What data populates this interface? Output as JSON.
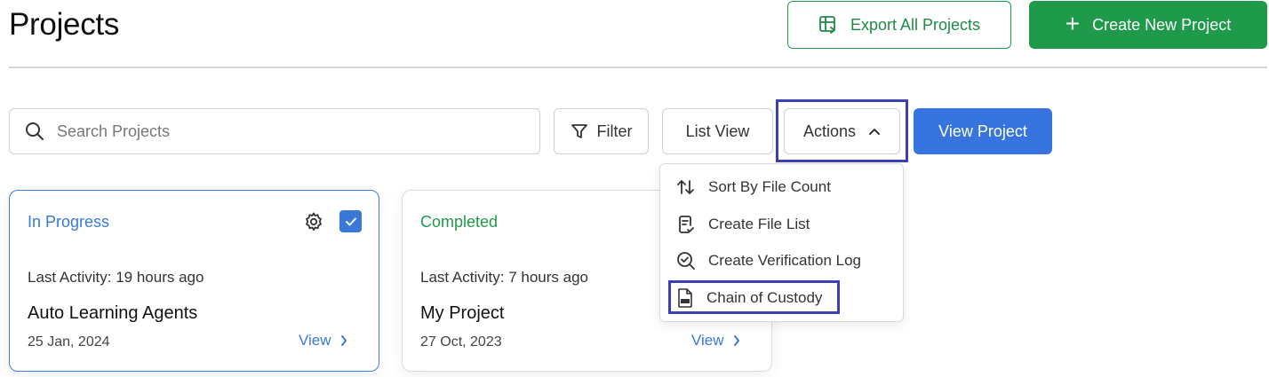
{
  "header": {
    "title": "Projects",
    "export_label": "Export All Projects",
    "create_label": "Create New Project"
  },
  "toolbar": {
    "search_placeholder": "Search Projects",
    "filter_label": "Filter",
    "list_view_label": "List View",
    "actions_label": "Actions",
    "view_project_label": "View Project"
  },
  "actions_menu": {
    "items": [
      {
        "label": "Sort By File Count",
        "icon": "sort-icon"
      },
      {
        "label": "Create File List",
        "icon": "file-list-icon"
      },
      {
        "label": "Create Verification Log",
        "icon": "verification-icon"
      },
      {
        "label": "Chain of Custody",
        "icon": "pdf-icon"
      }
    ]
  },
  "projects": [
    {
      "status": "In Progress",
      "activity": "Last Activity: 19 hours ago",
      "name": "Auto Learning Agents",
      "date": "25 Jan, 2024",
      "view_label": "View",
      "selected": true
    },
    {
      "status": "Completed",
      "activity": "Last Activity: 7 hours ago",
      "name": "My Project",
      "date": "27 Oct, 2023",
      "view_label": "View",
      "selected": false
    }
  ],
  "colors": {
    "green": "#1e9a4a",
    "blue": "#3774dd",
    "highlight": "#3d3fb5"
  }
}
